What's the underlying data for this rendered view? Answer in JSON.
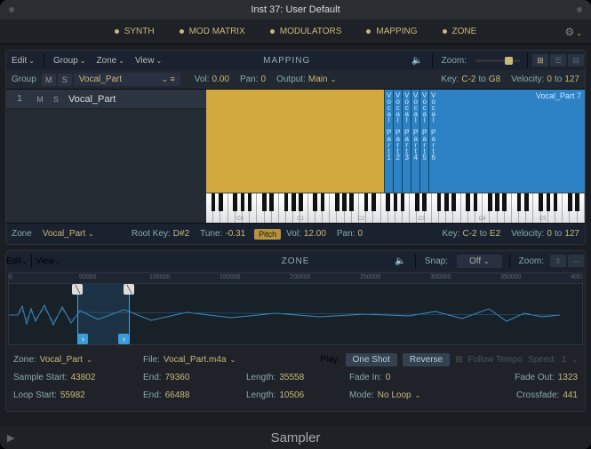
{
  "title": "Inst 37: User Default",
  "tabs": [
    "SYNTH",
    "MOD MATRIX",
    "MODULATORS",
    "MAPPING",
    "ZONE"
  ],
  "mapping": {
    "title": "MAPPING",
    "menus": {
      "edit": "Edit",
      "group": "Group",
      "zone": "Zone",
      "view": "View"
    },
    "zoom_label": "Zoom:",
    "group_row": {
      "label": "Group",
      "m": "M",
      "s": "S",
      "name": "Vocal_Part",
      "vol_label": "Vol:",
      "vol": "0.00",
      "pan_label": "Pan:",
      "pan": "0",
      "output_label": "Output:",
      "output": "Main",
      "key_label": "Key:",
      "key_lo": "C-2",
      "to": "to",
      "key_hi": "G8",
      "vel_label": "Velocity:",
      "vel_lo": "0",
      "vel_hi": "127"
    },
    "zones": {
      "index": "1",
      "m": "M",
      "s": "S",
      "name": "Vocal_Part",
      "group_label": "Vocal_Part 7",
      "cols": [
        "Vocal_Part1",
        "Vocal_Part2",
        "Vocal_Part3",
        "Vocal_Part4",
        "Vocal_Part5",
        "Vocal_Part6"
      ]
    },
    "octaves": [
      "C0",
      "C1",
      "C2",
      "C3",
      "C4",
      "C5"
    ],
    "zone_strip": {
      "label": "Zone",
      "name": "Vocal_Part",
      "rootkey_label": "Root Key:",
      "rootkey": "D#2",
      "tune_label": "Tune:",
      "tune": "-0.31",
      "pitch": "Pitch",
      "vol_label": "Vol:",
      "vol": "12.00",
      "pan_label": "Pan:",
      "pan": "0",
      "key_label": "Key:",
      "key_lo": "C-2",
      "to": "to",
      "key_hi": "E2",
      "vel_label": "Velocity:",
      "vel_lo": "0",
      "vel_hi": "127"
    }
  },
  "zone_panel": {
    "title": "ZONE",
    "menus": {
      "edit": "Edit",
      "view": "View"
    },
    "snap_label": "Snap:",
    "snap": "Off",
    "zoom_label": "Zoom:",
    "ruler": [
      "0",
      "50000",
      "100000",
      "150000",
      "200000",
      "250000",
      "300000",
      "350000",
      "400"
    ],
    "row0": {
      "zone_label": "Zone:",
      "zone": "Vocal_Part",
      "file_label": "File:",
      "file": "Vocal_Part.m4a",
      "play_label": "Play:",
      "oneshot": "One Shot",
      "reverse": "Reverse",
      "follow": "Follow Tempo",
      "speed_label": "Speed:",
      "speed": "1"
    },
    "row1": {
      "ss_label": "Sample Start:",
      "ss": "43802",
      "end_label": "End:",
      "end": "79360",
      "len_label": "Length:",
      "len": "35558",
      "fi_label": "Fade In:",
      "fi": "0",
      "fo_label": "Fade Out:",
      "fo": "1323"
    },
    "row2": {
      "ls_label": "Loop Start:",
      "ls": "55982",
      "end_label": "End:",
      "end": "66488",
      "len_label": "Length:",
      "len": "10506",
      "mode_label": "Mode:",
      "mode": "No Loop",
      "xf_label": "Crossfade:",
      "xf": "441"
    }
  },
  "footer": "Sampler"
}
